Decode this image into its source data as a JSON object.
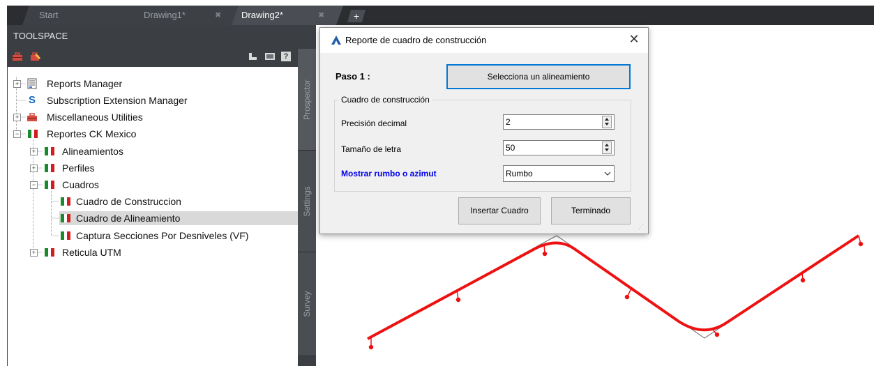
{
  "tabs": [
    {
      "label": "Start",
      "active": false
    },
    {
      "label": "Drawing1*",
      "active": false
    },
    {
      "label": "Drawing2*",
      "active": true
    }
  ],
  "new_tab_label": "+",
  "toolspace": {
    "title": "TOOLSPACE",
    "toolbar_icons": [
      "toolbox-icon",
      "edit-toolbox-icon",
      "pin-icon",
      "panel-icon",
      "help-icon"
    ],
    "help_label": "?",
    "tree": [
      {
        "label": "Reports Manager",
        "icon": "report-icon",
        "expander": "+"
      },
      {
        "label": "Subscription Extension Manager",
        "icon": "subscription-icon",
        "glyph": "S"
      },
      {
        "label": "Miscellaneous Utilities",
        "icon": "toolbox-icon",
        "expander": "+"
      },
      {
        "label": "Reportes CK Mexico",
        "icon": "mexico-flag-icon",
        "expander": "−"
      },
      {
        "label": "Alineamientos",
        "icon": "mexico-flag-icon",
        "expander": "+"
      },
      {
        "label": "Perfiles",
        "icon": "mexico-flag-icon",
        "expander": "+"
      },
      {
        "label": "Cuadros",
        "icon": "mexico-flag-icon",
        "expander": "−"
      },
      {
        "label": "Cuadro de Construccion",
        "icon": "mexico-flag-icon"
      },
      {
        "label": "Cuadro de Alineamiento",
        "icon": "mexico-flag-icon",
        "selected": true
      },
      {
        "label": "Captura Secciones Por Desniveles (VF)",
        "icon": "mexico-flag-icon"
      },
      {
        "label": "Reticula UTM",
        "icon": "mexico-flag-icon",
        "expander": "+"
      }
    ]
  },
  "side_tabs": [
    "Prospector",
    "Settings",
    "Survey"
  ],
  "dialog": {
    "title": "Reporte de cuadro de construcción",
    "close_glyph": "✕",
    "step_label": "Paso 1 :",
    "select_button": "Selecciona un alineamiento",
    "group_label": "Cuadro de construcción",
    "precision_label": "Precisión decimal",
    "precision_value": "2",
    "font_size_label": "Tamaño de letra",
    "font_size_value": "50",
    "bearing_label": "Mostrar rumbo o azimut",
    "bearing_value": "Rumbo",
    "insert_button": "Insertar Cuadro",
    "done_button": "Terminado"
  },
  "colors": {
    "alignment": "#ee1111",
    "bearing_label": "#0000ee",
    "flag_green": "#1b8a2d",
    "flag_red": "#d11f1f"
  }
}
